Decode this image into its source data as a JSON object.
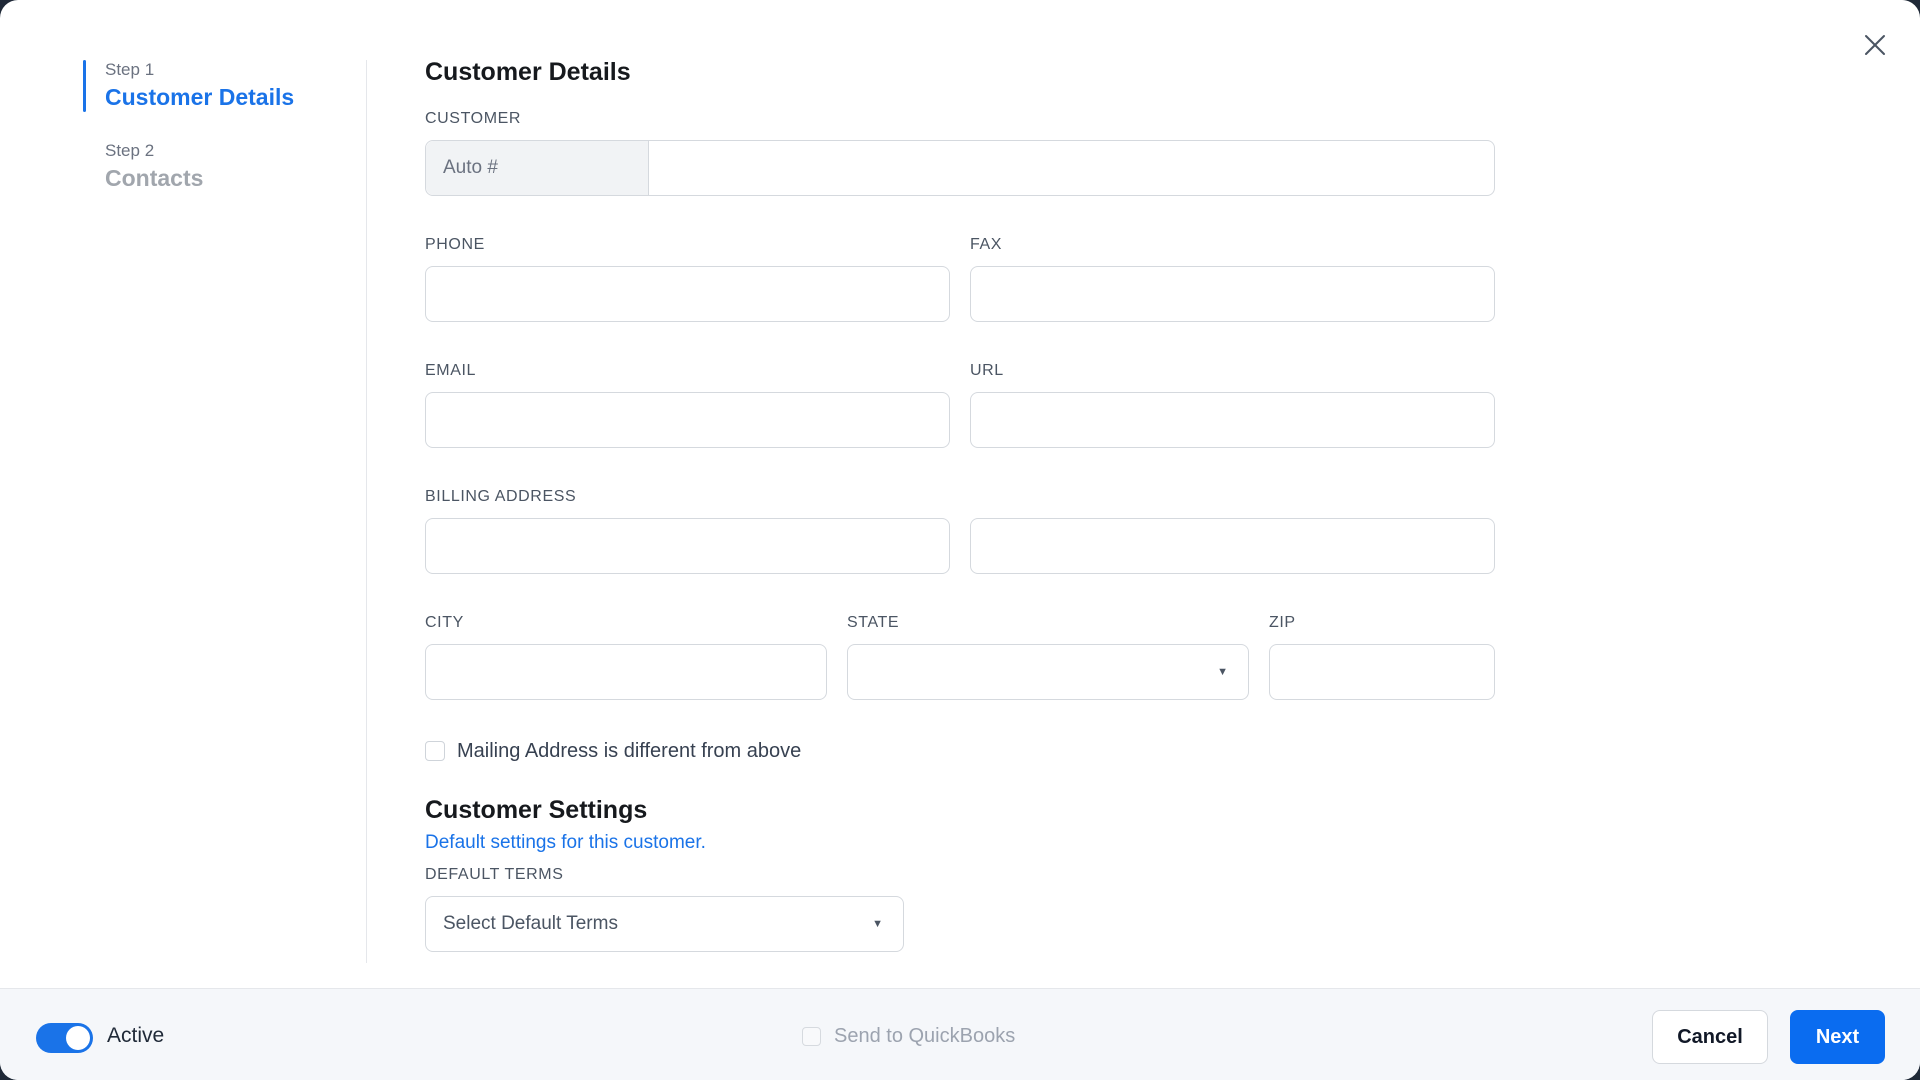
{
  "stepper": {
    "steps": [
      {
        "label": "Step 1",
        "title": "Customer Details"
      },
      {
        "label": "Step 2",
        "title": "Contacts"
      }
    ]
  },
  "form": {
    "title": "Customer Details",
    "customer": {
      "label": "CUSTOMER",
      "prefix": "Auto #",
      "value": ""
    },
    "phone": {
      "label": "PHONE",
      "value": ""
    },
    "fax": {
      "label": "FAX",
      "value": ""
    },
    "email": {
      "label": "EMAIL",
      "value": ""
    },
    "url": {
      "label": "URL",
      "value": ""
    },
    "billing_address": {
      "label": "BILLING ADDRESS",
      "line1": "",
      "line2": ""
    },
    "city": {
      "label": "CITY",
      "value": ""
    },
    "state": {
      "label": "STATE",
      "value": ""
    },
    "zip": {
      "label": "ZIP",
      "value": ""
    },
    "mailing_checkbox": {
      "label": "Mailing Address is different from above",
      "checked": false
    }
  },
  "settings": {
    "title": "Customer Settings",
    "subtitle": "Default settings for this customer.",
    "default_terms": {
      "label": "DEFAULT TERMS",
      "placeholder": "Select Default Terms"
    }
  },
  "footer": {
    "active_label": "Active",
    "active_on": true,
    "send_qb_label": "Send to QuickBooks",
    "send_qb_checked": false,
    "cancel_label": "Cancel",
    "next_label": "Next"
  },
  "colors": {
    "accent": "#1a73e8",
    "primary_button": "#0a6cf0",
    "footer_bg": "#f5f7fa"
  },
  "icons": {
    "close": "close-icon",
    "caret": "caret-down-icon"
  }
}
